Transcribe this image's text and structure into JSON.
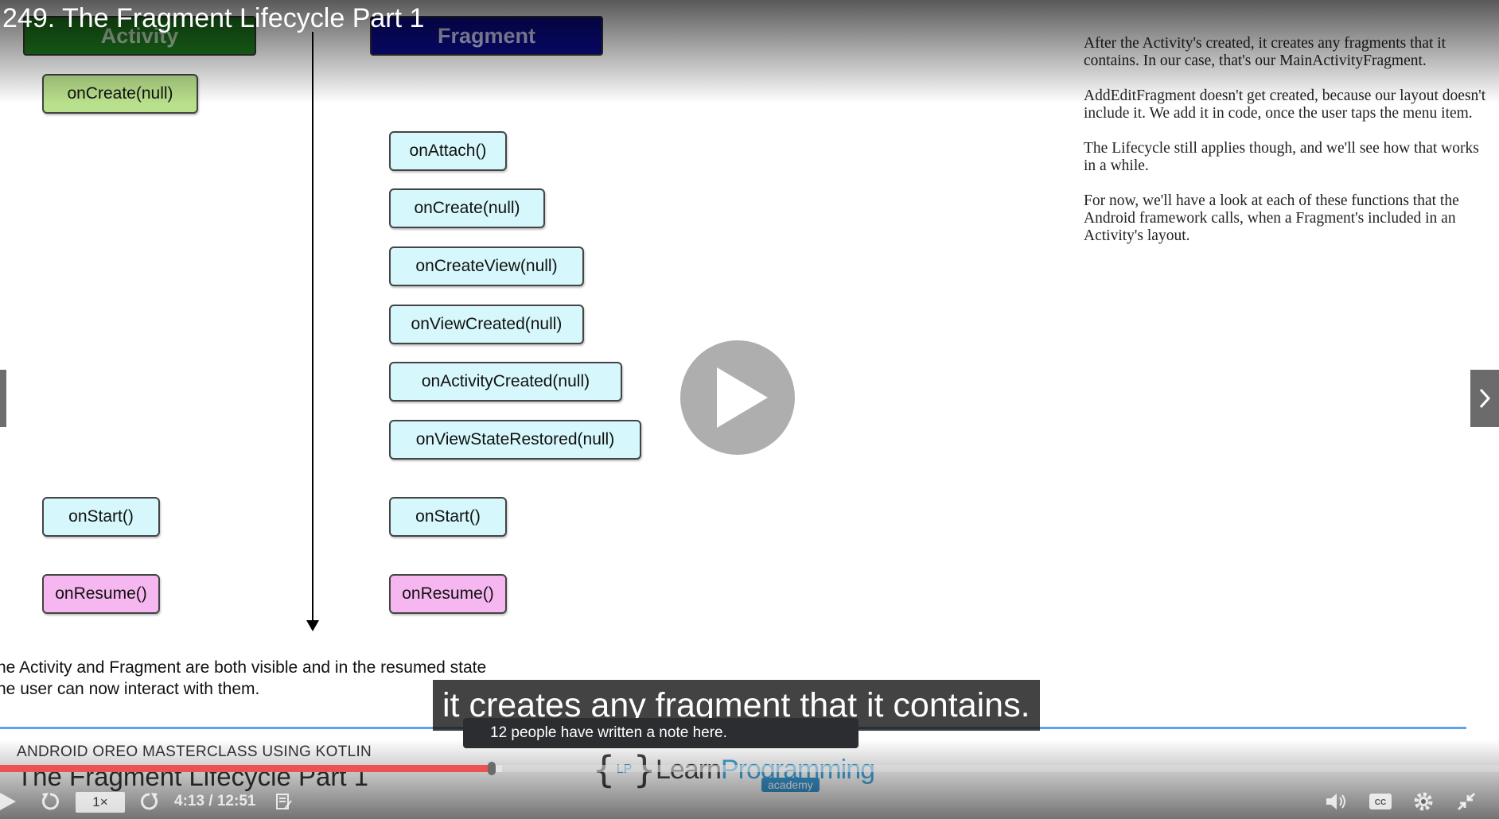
{
  "video": {
    "title": "249. The Fragment Lifecycle Part 1"
  },
  "slide": {
    "lanes": {
      "activity": "Activity",
      "fragment": "Fragment"
    },
    "activity_methods": {
      "on_create": "onCreate(null)",
      "on_start": "onStart()",
      "on_resume": "onResume()"
    },
    "fragment_methods": {
      "on_attach": "onAttach()",
      "on_create": "onCreate(null)",
      "on_create_view": "onCreateView(null)",
      "on_view_created": "onViewCreated(null)",
      "on_activity_created": "onActivityCreated(null)",
      "on_view_state_restored": "onViewStateRestored(null)",
      "on_start": "onStart()",
      "on_resume": "onResume()"
    },
    "notes": [
      "After the Activity's created, it creates any fragments that it contains. In our case, that's our MainActivityFragment.",
      "AddEditFragment doesn't get created, because our layout doesn't include it. We add it in code, once the user taps the menu item.",
      "The Lifecycle still applies though, and we'll see how that works in a while.",
      "For now, we'll have a look at each of these functions that the Android framework calls, when a Fragment's included in an Activity's layout."
    ],
    "bottom_lines": [
      "he Activity and Fragment are both visible and in the resumed state",
      "he user can now interact with them."
    ],
    "course_name": "ANDROID OREO MASTERCLASS USING KOTLIN",
    "lecture_name": "The Fragment Lifecycle Part 1",
    "logo": {
      "lp": "LP",
      "learn": "Learn",
      "programming": "Programming",
      "academy": "academy"
    }
  },
  "player": {
    "caption": "it creates any fragment that it contains.",
    "note_tooltip": "12 people have written a note here.",
    "progress": {
      "played_fraction": 0.3281,
      "buffered_fraction": 0.335
    },
    "speed": "1×",
    "time": "4:13 / 12:51",
    "icons": {
      "play": "play-icon",
      "rewind": "rewind-icon",
      "forward": "forward-icon",
      "notes": "notes-icon",
      "volume": "volume-icon",
      "captions": "captions-icon",
      "settings": "gear-icon",
      "fullscreen": "exit-fullscreen-icon"
    },
    "accent_color": "#ec5252"
  }
}
